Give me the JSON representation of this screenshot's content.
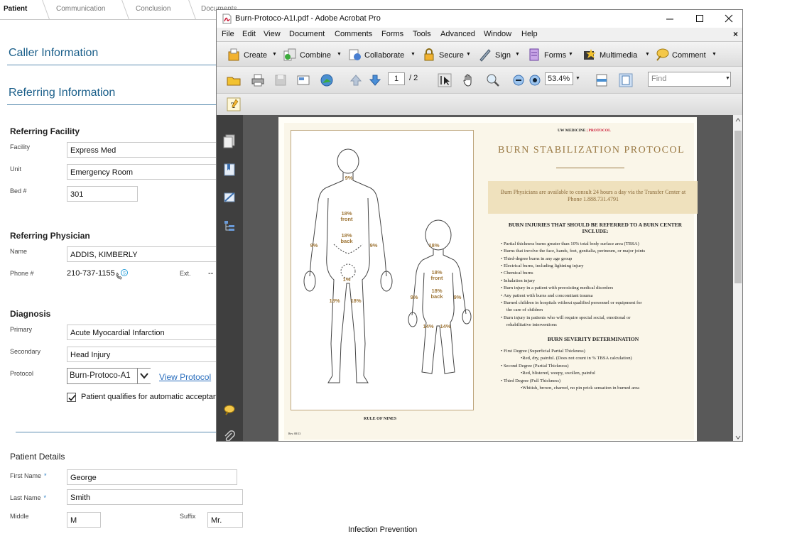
{
  "tabs": [
    "Patient",
    "Communication",
    "Conclusion",
    "Documents"
  ],
  "caller_info_title": "Caller Information",
  "referring_info_title": "Referring Information",
  "referring_facility": {
    "title": "Referring Facility",
    "facility_label": "Facility",
    "facility_value": "Express Med",
    "unit_label": "Unit",
    "unit_value": "Emergency Room",
    "bed_label": "Bed #",
    "bed_value": "301"
  },
  "referring_physician": {
    "title": "Referring Physician",
    "name_label": "Name",
    "name_value": "ADDIS, KIMBERLY",
    "phone_label": "Phone #",
    "phone_value": "210-737-1155",
    "ext_label": "Ext.",
    "ext_value": "--"
  },
  "diagnosis": {
    "title": "Diagnosis",
    "primary_label": "Primary",
    "primary_value": "Acute Myocardial Infarction",
    "secondary_label": "Secondary",
    "secondary_value": "Head Injury",
    "protocol_label": "Protocol",
    "protocol_value": "Burn-Protoco-A1",
    "view_protocol": "View Protocol",
    "auto_accept_label": "Patient qualifies for automatic acceptan",
    "auto_accept_checked": true
  },
  "patient_details": {
    "title": "Patient Details",
    "first_label": "First Name",
    "first_value": "George",
    "last_label": "Last Name",
    "last_value": "Smith",
    "middle_label": "Middle",
    "middle_value": "M",
    "suffix_label": "Suffix",
    "suffix_value": "Mr.",
    "required_mark": "*"
  },
  "bottom_cut_text": "Infection Prevention",
  "acrobat": {
    "title": "Burn-Protoco-A1I.pdf - Adobe Acrobat Pro",
    "menus": [
      "File",
      "Edit",
      "View",
      "Document",
      "Comments",
      "Forms",
      "Tools",
      "Advanced",
      "Window",
      "Help"
    ],
    "menu_close": "×",
    "toolbar": [
      "Create",
      "Combine",
      "Collaborate",
      "Secure",
      "Sign",
      "Forms",
      "Multimedia",
      "Comment"
    ],
    "page_current": "1",
    "page_total": "/ 2",
    "zoom": "53.4%",
    "find_placeholder": "Find"
  },
  "pdf": {
    "header_left": "UW MEDICINE",
    "header_sep": "|",
    "header_right": "PROTOCOL",
    "title": "BURN STABILIZATION PROTOCOL",
    "banner": "Burn Physicians are available to consult 24 hours a day via the Transfer Center at Phone 1.888.731.4791",
    "refer_heading": "BURN INJURIES THAT SHOULD BE REFERRED TO A BURN CENTER INCLUDE:",
    "refer_items": [
      "Partial thickness burns greater than 10% total body surface area (TBSA)",
      "Burns that involve the face, hands, feet, genitalia, perineum, or major joints",
      "Third-degree burns in any age group",
      "Electrical burns, including lightning injury",
      "Chemical burns",
      "Inhalation injury",
      "Burn injury in a patient with preexisting medical disorders",
      "Any patient with burns and concomitant trauma",
      "Burned children in hospitals without qualified personnel or equipment for",
      "the care of children",
      "Burn injury in patients who will require special social, emotional or",
      "rehabilitative interventions"
    ],
    "severity_heading": "BURN SEVERITY DETERMINATION",
    "severity_items": [
      "First Degree (Superficial Partial Thickness)",
      "•Red, dry, painful. (Does not count in % TBSA calculation)",
      "Second Degree (Partial Thickness)",
      "•Red, blistered, weepy, swollen, painful",
      "Third Degree (Full Thickness)",
      "•Whitish, brown, charred, no pin prick sensation in burned area"
    ],
    "rule_caption": "RULE OF NINES",
    "rev_text": "Rev. 08/13",
    "adult_labels": {
      "head": "9%",
      "front": "18%\nfront",
      "back": "18%\nback",
      "arm_l": "9%",
      "arm_r": "9%",
      "groin": "1%",
      "leg_l": "18%",
      "leg_r": "18%"
    },
    "child_labels": {
      "head": "18%",
      "front": "18%\nfront",
      "back": "18%\nback",
      "arm_l": "9%",
      "arm_r": "9%",
      "leg_l": "14%",
      "leg_r": "14%"
    }
  }
}
